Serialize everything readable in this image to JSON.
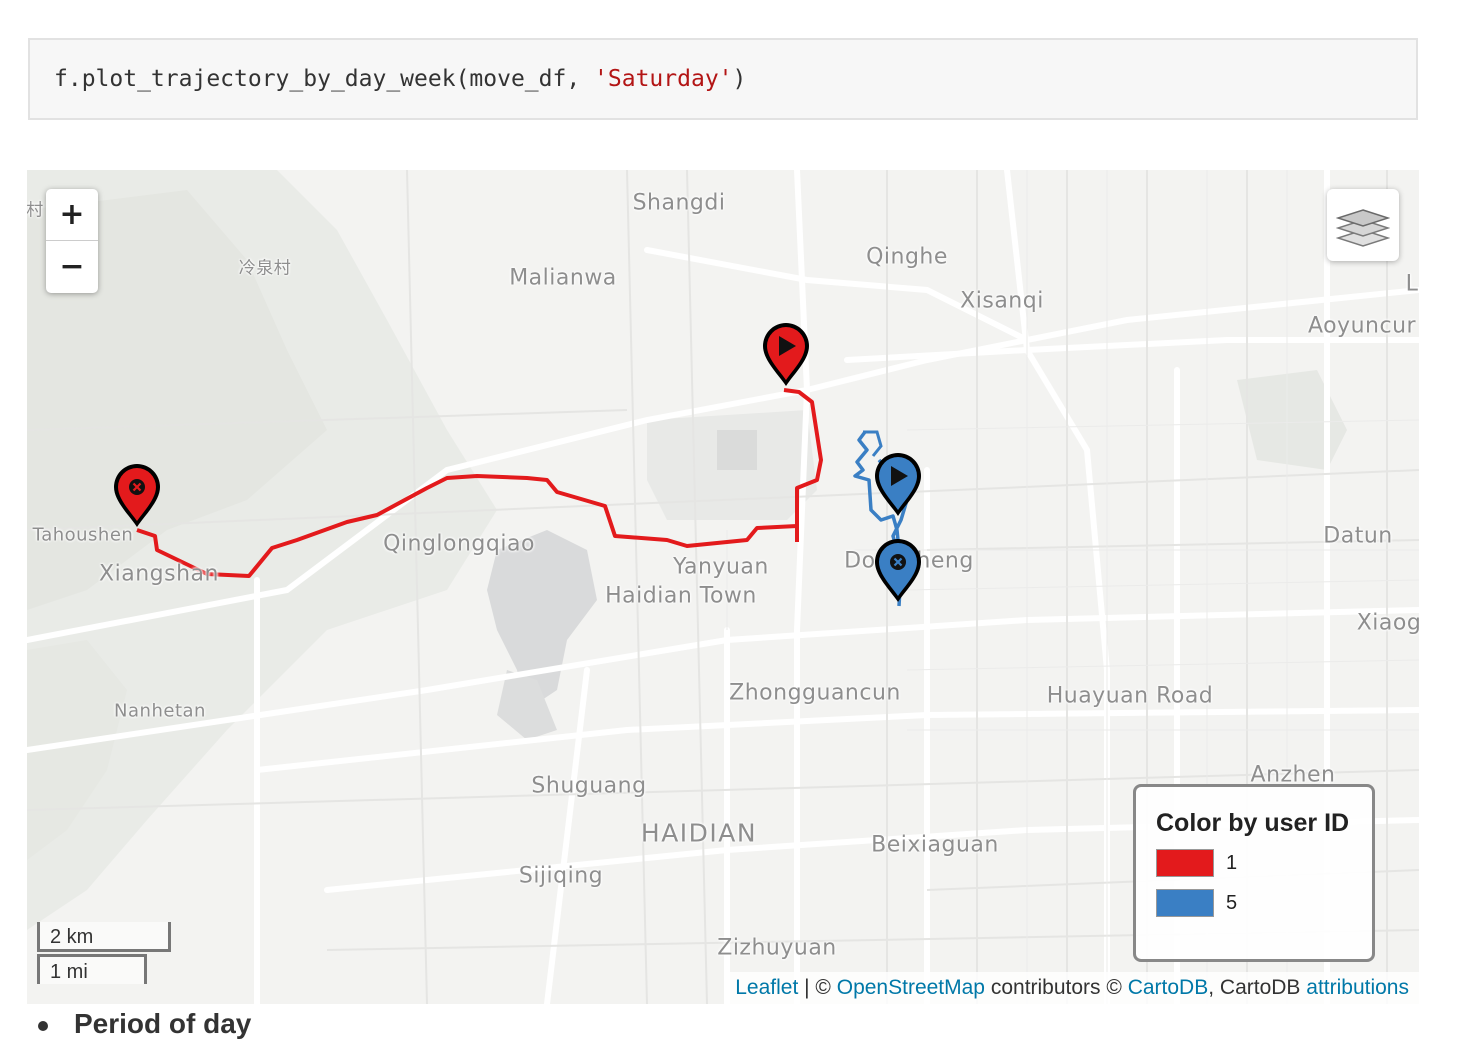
{
  "code": {
    "prefix": "f.plot_trajectory_by_day_week(move_df, ",
    "string_arg": "'Saturday'",
    "suffix": ")"
  },
  "map": {
    "places": {
      "fragment_left": "村",
      "shangdi": "Shangdi",
      "lengquan": "冷泉村",
      "malianwa": "Malianwa",
      "qinghe": "Qinghe",
      "xisanqi": "Xisanqi",
      "aoyuncun": "Aoyuncur",
      "l_fragment": "L",
      "tahoushen": "Tahoushen",
      "xiangshan": "Xiangshan",
      "qinglongqiao": "Qinglongqiao",
      "yanyuan": "Yanyuan",
      "haidian_town": "Haidian Town",
      "dongsheng": "Dongsheng",
      "datun": "Datun",
      "xiaog": "Xiaog",
      "zhongguancun": "Zhongguancun",
      "huayuan_road": "Huayuan Road",
      "nanhetan": "Nanhetan",
      "anzhen": "Anzhen",
      "shuguang": "Shuguang",
      "haidian": "HAIDIAN",
      "beixiaguan": "Beixiaguan",
      "sijiqing": "Sijiqing",
      "zizhuyuan": "Zizhuyuan"
    },
    "zoom": {
      "in": "+",
      "out": "−"
    },
    "layers_icon": "layers-icon",
    "scale": {
      "km": "2 km",
      "mi": "1 mi"
    },
    "legend": {
      "title": "Color by user ID",
      "items": [
        {
          "label": "1",
          "color": "#e31a1c"
        },
        {
          "label": "5",
          "color": "#3a7fc4"
        }
      ]
    },
    "attribution": {
      "leaflet": "Leaflet",
      "sep1": " | © ",
      "osm": "OpenStreetMap",
      "contributors": " contributors © ",
      "cartodb": "CartoDB",
      "sep2": ", CartoDB ",
      "attributions": "attributions"
    },
    "markers": [
      {
        "user": "1",
        "type": "start",
        "icon": "play-icon",
        "color": "#e31a1c"
      },
      {
        "user": "1",
        "type": "end",
        "icon": "times-circle-icon",
        "color": "#e31a1c"
      },
      {
        "user": "5",
        "type": "start",
        "icon": "play-icon",
        "color": "#3a7fc4"
      },
      {
        "user": "5",
        "type": "end",
        "icon": "times-circle-icon",
        "color": "#3a7fc4"
      }
    ]
  },
  "section": {
    "heading": "Period of day"
  }
}
